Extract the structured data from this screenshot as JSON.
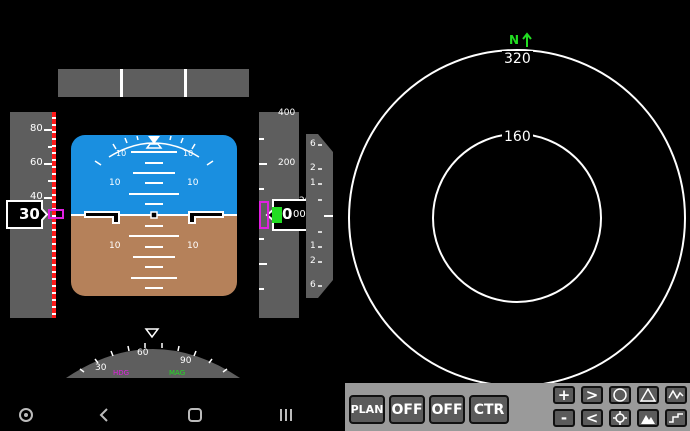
{
  "colors": {
    "sky": "#1a8fe0",
    "ground": "#b5815a",
    "tape": "#5e5e5e",
    "magenta": "#e020e0",
    "green": "#22dd22",
    "panel": "#9a9a9a"
  },
  "speed_tape": {
    "labels": [
      "80",
      "60",
      "40"
    ],
    "current_speed": "30"
  },
  "altitude_tape": {
    "top_label": "400",
    "labels": [
      "200",
      "20"
    ],
    "current_altitude_big": "0",
    "current_altitude_small": "000"
  },
  "vertical_speed": {
    "labels": [
      "6",
      "2",
      "1",
      "1",
      "2",
      "6"
    ]
  },
  "attitude": {
    "pitch_labels": [
      "10",
      "10",
      "10",
      "10"
    ]
  },
  "heading": {
    "labels": [
      "30",
      "60",
      "90"
    ],
    "hdg_label": "HDG",
    "mag_label": "MAG"
  },
  "nav_display": {
    "north_label": "N",
    "outer_range": "320",
    "inner_range": "160"
  },
  "controls": {
    "mode_buttons": [
      "PLAN",
      "OFF",
      "OFF",
      "CTR"
    ],
    "plus_label": "+",
    "minus_label": "-",
    "right_label": ">",
    "left_label": "<"
  },
  "android_nav": {
    "icons": [
      "settings-icon",
      "back-icon",
      "home-icon",
      "recents-icon"
    ]
  }
}
